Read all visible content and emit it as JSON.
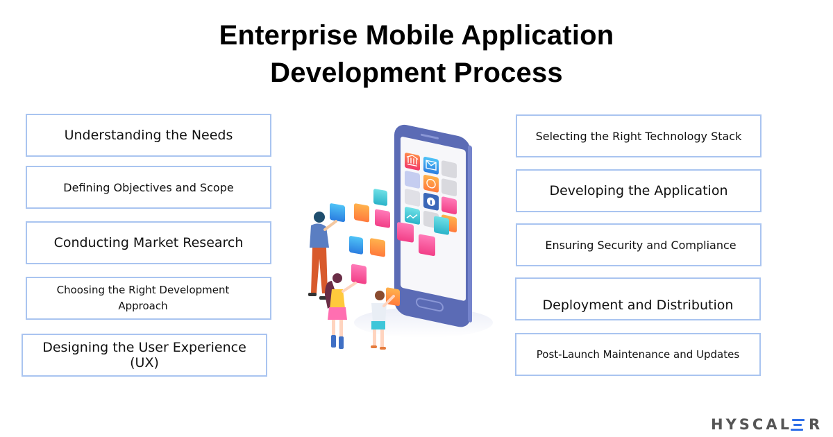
{
  "title": {
    "line1": "Enterprise Mobile Application",
    "line2": "Development Process"
  },
  "steps_left": [
    {
      "label": "Understanding the Needs"
    },
    {
      "label": "Defining Objectives and Scope"
    },
    {
      "label": "Conducting Market Research"
    },
    {
      "label": "Choosing the Right Development Approach"
    },
    {
      "label": "Designing the User Experience (UX)"
    }
  ],
  "steps_right": [
    {
      "label": "Selecting the Right Technology Stack"
    },
    {
      "label": "Developing the Application"
    },
    {
      "label": "Ensuring Security and Compliance"
    },
    {
      "label": "Deployment and Distribution"
    },
    {
      "label": "Post-Launch Maintenance and Updates"
    }
  ],
  "illustration": {
    "description": "people-arranging-app-icons-on-smartphone",
    "icons": [
      "bank-icon",
      "mail-icon",
      "clock-icon",
      "music-icon",
      "play-icon",
      "info-icon",
      "chart-icon",
      "cart-icon",
      "folder-icon",
      "analytics-icon",
      "settings-icon",
      "speedometer-icon",
      "globe-icon",
      "lock-icon",
      "camera-icon",
      "shopping-bag-icon",
      "gamepad-icon"
    ]
  },
  "logo": {
    "prefix": "HYSCAL",
    "suffix": "R"
  },
  "colors": {
    "box_border": "#a9c4f0",
    "phone_body": "#5b6bb5",
    "logo_text": "#555555",
    "logo_accent": "#2f6fe8"
  }
}
